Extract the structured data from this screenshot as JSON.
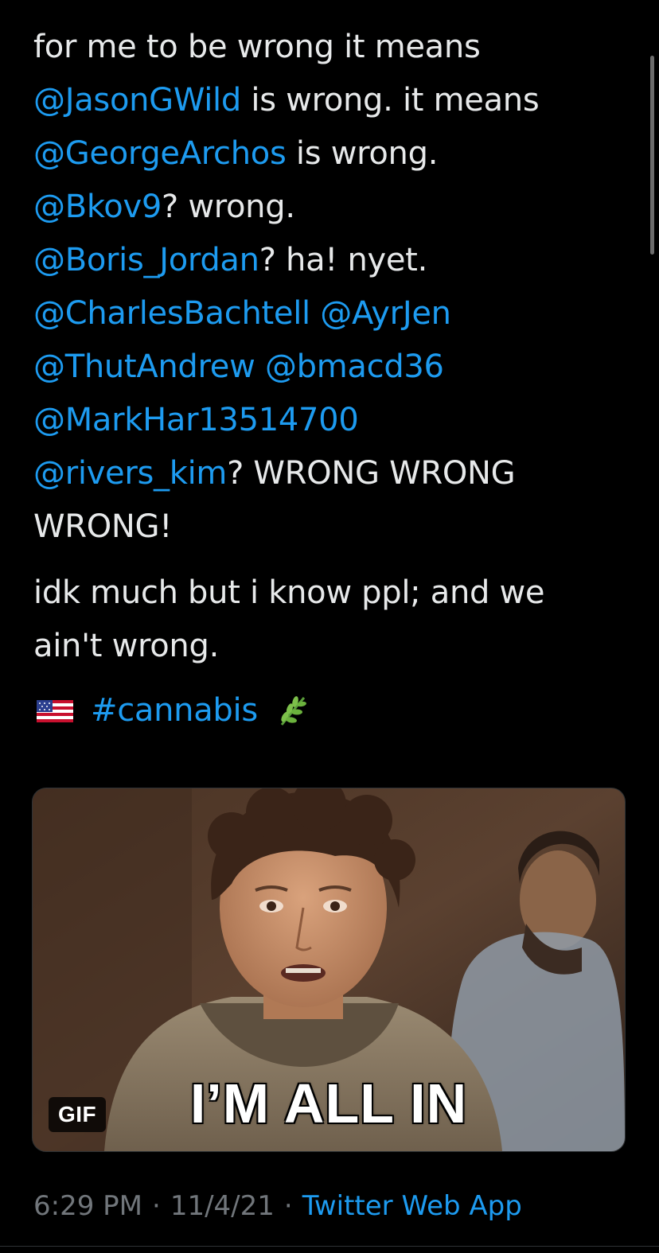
{
  "tweet": {
    "lines": [
      [
        {
          "t": "for me to be wrong it means",
          "k": "text"
        }
      ],
      [
        {
          "t": "@JasonGWild",
          "k": "mention"
        },
        {
          "t": " is wrong. it means",
          "k": "text"
        }
      ],
      [
        {
          "t": "@GeorgeArchos",
          "k": "mention"
        },
        {
          "t": " is wrong.",
          "k": "text"
        }
      ],
      [
        {
          "t": "@Bkov9",
          "k": "mention"
        },
        {
          "t": "? wrong.",
          "k": "text"
        }
      ],
      [
        {
          "t": "@Boris_Jordan",
          "k": "mention"
        },
        {
          "t": "? ha! nyet.",
          "k": "text"
        }
      ],
      [
        {
          "t": "@CharlesBachtell",
          "k": "mention"
        },
        {
          "t": " ",
          "k": "text"
        },
        {
          "t": "@AyrJen",
          "k": "mention"
        }
      ],
      [
        {
          "t": "@ThutAndrew",
          "k": "mention"
        },
        {
          "t": " ",
          "k": "text"
        },
        {
          "t": "@bmacd36",
          "k": "mention"
        }
      ],
      [
        {
          "t": "@MarkHar13514700",
          "k": "mention"
        }
      ],
      [
        {
          "t": "@rivers_kim",
          "k": "mention"
        },
        {
          "t": "? WRONG WRONG",
          "k": "text"
        }
      ],
      [
        {
          "t": "WRONG!",
          "k": "text"
        }
      ]
    ],
    "paragraph2": [
      "idk much but i know ppl; and we",
      "ain't wrong."
    ],
    "hashtag": "#cannabis",
    "flag_icon": "us-flag-emoji",
    "herb_icon": "herb-emoji"
  },
  "media": {
    "gif_badge": "GIF",
    "caption": "I’M ALL IN"
  },
  "meta": {
    "time": "6:29 PM",
    "separator": "·",
    "date": "11/4/21",
    "source": "Twitter Web App"
  },
  "colors": {
    "background": "#000000",
    "text": "#e7e9ea",
    "link": "#1d9bf0",
    "muted": "#71767b"
  }
}
